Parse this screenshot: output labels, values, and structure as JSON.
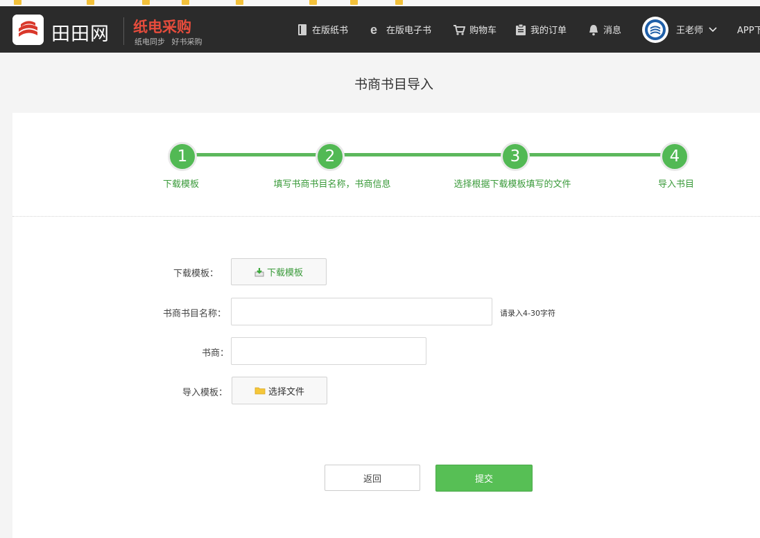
{
  "header": {
    "logo_text": "田田网",
    "subtitle": "纸电采购",
    "tagline": "纸电同步  好书采购",
    "nav": [
      {
        "label": "在版纸书",
        "icon": "book-icon"
      },
      {
        "label": "在版电子书",
        "icon": "e-icon"
      },
      {
        "label": "购物车",
        "icon": "cart-icon"
      },
      {
        "label": "我的订单",
        "icon": "clipboard-icon"
      },
      {
        "label": "消息",
        "icon": "bell-icon"
      }
    ],
    "user_name": "王老师",
    "app_label": "APP下"
  },
  "page": {
    "title": "书商书目导入"
  },
  "steps": [
    {
      "number": "1",
      "label": "下载模板"
    },
    {
      "number": "2",
      "label": "填写书商书目名称，书商信息"
    },
    {
      "number": "3",
      "label": "选择根据下载模板填写的文件"
    },
    {
      "number": "4",
      "label": "导入书目"
    }
  ],
  "form": {
    "download_template_label": "下载模板：",
    "download_button": "下载模板",
    "catalog_name_label": "书商书目名称：",
    "catalog_name_value": "",
    "catalog_name_hint": "请录入4-30字符",
    "vendor_label": "书商：",
    "vendor_value": "",
    "import_template_label": "导入模板：",
    "choose_file_button": "选择文件"
  },
  "actions": {
    "back": "返回",
    "submit": "提交"
  },
  "colors": {
    "topbar": "#2b2b2b",
    "accent_green": "#57bf55",
    "brand_red": "#e74c3c"
  }
}
